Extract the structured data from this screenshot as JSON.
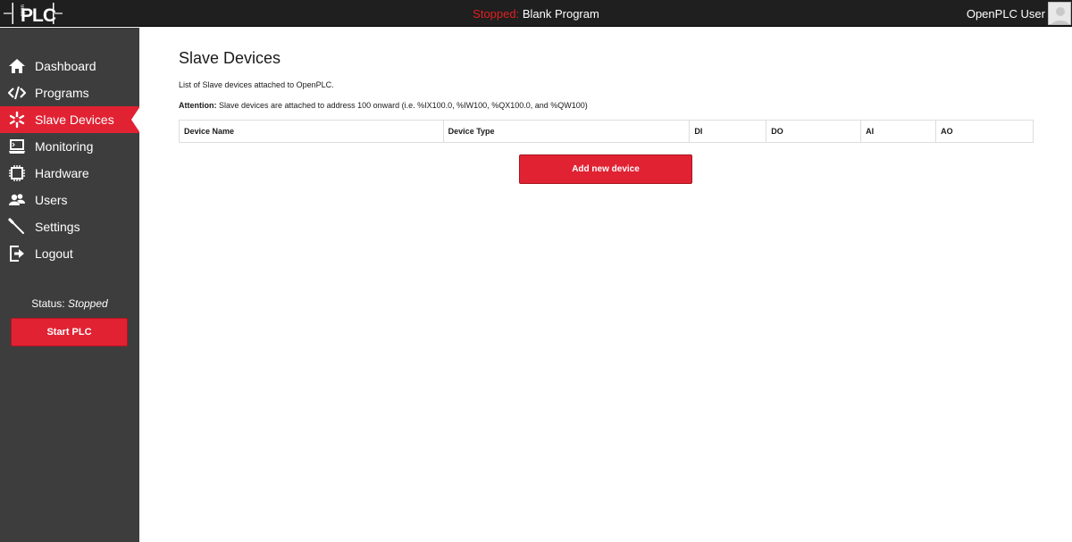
{
  "header": {
    "logo_text": "PLC",
    "status_prefix": "Stopped:",
    "program_name": "Blank Program",
    "user_name": "OpenPLC User"
  },
  "sidebar": {
    "items": [
      {
        "label": "Dashboard",
        "icon": "home-icon"
      },
      {
        "label": "Programs",
        "icon": "code-icon"
      },
      {
        "label": "Slave Devices",
        "icon": "asterisk-icon",
        "active": true
      },
      {
        "label": "Monitoring",
        "icon": "monitor-icon"
      },
      {
        "label": "Hardware",
        "icon": "chip-icon"
      },
      {
        "label": "Users",
        "icon": "users-icon"
      },
      {
        "label": "Settings",
        "icon": "wrench-icon"
      },
      {
        "label": "Logout",
        "icon": "logout-icon"
      }
    ],
    "status_label": "Status:",
    "status_value": "Stopped",
    "start_button": "Start PLC"
  },
  "main": {
    "title": "Slave Devices",
    "description": "List of Slave devices attached to OpenPLC.",
    "attention_label": "Attention:",
    "attention_text": "Slave devices are attached to address 100 onward (i.e. %IX100.0, %IW100, %QX100.0, and %QW100)",
    "table_headers": [
      "Device Name",
      "Device Type",
      "DI",
      "DO",
      "AI",
      "AO"
    ],
    "add_button": "Add new device"
  },
  "colors": {
    "accent": "#e02233",
    "topbar": "#1f1f1f",
    "sidebar": "#3d3d3d",
    "stopped_text": "#e02020"
  }
}
